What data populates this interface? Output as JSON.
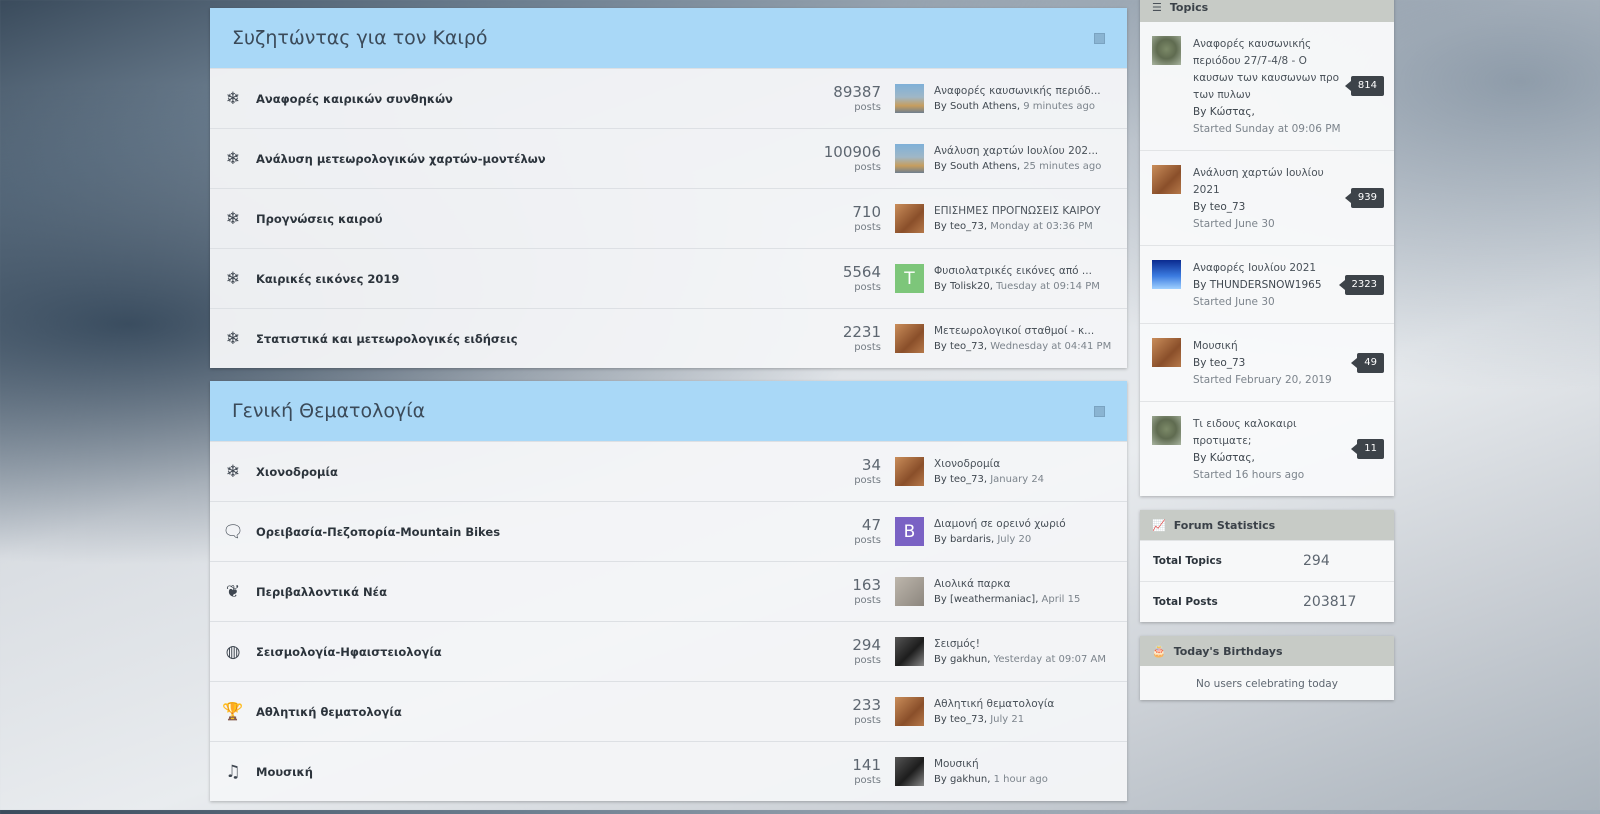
{
  "categories": [
    {
      "title": "Συζητώντας για τον Καιρό",
      "forums": [
        {
          "icon": "❄",
          "icon_name": "snowflake-icon",
          "name": "Αναφορές καιρικών συνθηκών",
          "count": "89387",
          "count_label": "posts",
          "avatar": "city",
          "avatar_letter": "",
          "last_title": "Αναφορές καυσωνικής περιόδ...",
          "by": "By South Athens",
          "time": "9 minutes ago"
        },
        {
          "icon": "❄",
          "icon_name": "snowflake-icon",
          "name": "Ανάλυση μετεωρολογικών χαρτών-μοντέλων",
          "count": "100906",
          "count_label": "posts",
          "avatar": "city",
          "avatar_letter": "",
          "last_title": "Ανάλυση χαρτών Ιουλίου 202...",
          "by": "By South Athens",
          "time": "25 minutes ago"
        },
        {
          "icon": "❄",
          "icon_name": "snowflake-icon",
          "name": "Προγνώσεις καιρού",
          "count": "710",
          "count_label": "posts",
          "avatar": "brown",
          "avatar_letter": "",
          "last_title": "ΕΠΙΣΗΜΕΣ ΠΡΟΓΝΩΣΕΙΣ ΚΑΙΡΟΥ",
          "by": "By teo_73",
          "time": "Monday at 03:36 PM"
        },
        {
          "icon": "❄",
          "icon_name": "snowflake-icon",
          "name": "Καιρικές εικόνες 2019",
          "count": "5564",
          "count_label": "posts",
          "avatar": "letter",
          "avatar_letter": "T",
          "avatar_color": "#7dc67a",
          "last_title": "Φυσιολατρικές εικόνες από ...",
          "by": "By Tolisk20",
          "time": "Tuesday at 09:14 PM"
        },
        {
          "icon": "❄",
          "icon_name": "snowflake-icon",
          "name": "Στατιστικά και μετεωρολογικές ειδήσεις",
          "count": "2231",
          "count_label": "posts",
          "avatar": "brown",
          "avatar_letter": "",
          "last_title": "Μετεωρολογικοί σταθμοί - κ...",
          "by": "By teo_73",
          "time": "Wednesday at 04:41 PM"
        }
      ]
    },
    {
      "title": "Γενική Θεματολογία",
      "forums": [
        {
          "icon": "❄",
          "icon_name": "snowflake-icon",
          "name": "Χιονοδρομία",
          "count": "34",
          "count_label": "posts",
          "avatar": "brown",
          "avatar_letter": "",
          "last_title": "Χιονοδρομία",
          "by": "By teo_73",
          "time": "January 24"
        },
        {
          "icon": "🗨",
          "icon_name": "comments-icon",
          "name": "Ορειβασία-Πεζοπορία-Mountain Bikes",
          "count": "47",
          "count_label": "posts",
          "avatar": "letter",
          "avatar_letter": "B",
          "avatar_color": "#7a62c4",
          "last_title": "Διαμονή σε ορεινό χωριό",
          "by": "By bardaris",
          "time": "July 20"
        },
        {
          "icon": "❦",
          "icon_name": "leaf-icon",
          "name": "Περιβαλλοντικά Νέα",
          "count": "163",
          "count_label": "posts",
          "avatar": "gray",
          "avatar_letter": "",
          "last_title": "Αιολικά παρκα",
          "by": "By [weathermaniac]",
          "time": "April 15"
        },
        {
          "icon": "◍",
          "icon_name": "globe-icon",
          "name": "Σεισμολογία-Ηφαιστειολογία",
          "count": "294",
          "count_label": "posts",
          "avatar": "dark",
          "avatar_letter": "",
          "last_title": "Σεισμός!",
          "by": "By gakhun",
          "time": "Yesterday at 09:07 AM"
        },
        {
          "icon": "🏆",
          "icon_name": "trophy-icon",
          "name": "Αθλητική θεματολογία",
          "count": "233",
          "count_label": "posts",
          "avatar": "brown",
          "avatar_letter": "",
          "last_title": "Αθλητική θεματολογία",
          "by": "By teo_73",
          "time": "July 21"
        },
        {
          "icon": "♫",
          "icon_name": "music-icon",
          "name": "Μουσική",
          "count": "141",
          "count_label": "posts",
          "avatar": "dark",
          "avatar_letter": "",
          "last_title": "Μουσική",
          "by": "By gakhun",
          "time": "1 hour ago"
        }
      ]
    }
  ],
  "sidebar": {
    "topics": {
      "title": "Topics",
      "items": [
        {
          "avatar": "monkey",
          "title": "Αναφορές καυσωνικής περιόδου 27/7-4/8 - Ο καυσων των καυσωνων προ των πυλων",
          "author": "By Κώστας,",
          "started": "Started Sunday at 09:06 PM",
          "replies": "814"
        },
        {
          "avatar": "brown",
          "title": "Ανάλυση χαρτών Ιουλίου 2021",
          "author": "By teo_73",
          "started": "Started June 30",
          "replies": "939"
        },
        {
          "avatar": "blue",
          "title": "Αναφορές Ιουλίου 2021",
          "author": "By THUNDERSNOW1965",
          "started": "Started June 30",
          "replies": "2323"
        },
        {
          "avatar": "brown",
          "title": "Μουσική",
          "author": "By teo_73",
          "started": "Started February 20, 2019",
          "replies": "49"
        },
        {
          "avatar": "monkey",
          "title": "Τι ειδους καλοκαιρι προτιματε;",
          "author": "By Κώστας,",
          "started": "Started 16 hours ago",
          "replies": "11"
        }
      ]
    },
    "stats": {
      "title": "Forum Statistics",
      "rows": [
        {
          "label": "Total Topics",
          "value": "294"
        },
        {
          "label": "Total Posts",
          "value": "203817"
        }
      ]
    },
    "birthdays": {
      "title": "Today's Birthdays",
      "empty": "No users celebrating today"
    }
  }
}
